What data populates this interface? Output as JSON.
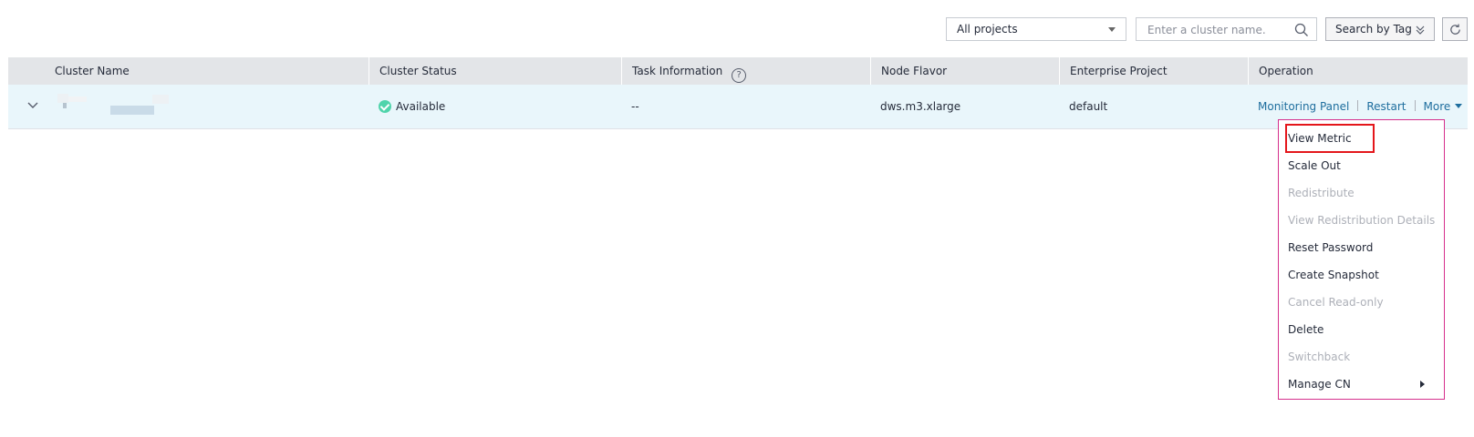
{
  "toolbar": {
    "project_select": "All projects",
    "search_placeholder": "Enter a cluster name.",
    "search_by_tag": "Search by Tag"
  },
  "table": {
    "columns": [
      "Cluster Name",
      "Cluster Status",
      "Task Information",
      "Node Flavor",
      "Enterprise Project",
      "Operation"
    ],
    "row": {
      "cluster_name": "",
      "status": "Available",
      "task_information": "--",
      "node_flavor": "dws.m3.xlarge",
      "enterprise_project": "default",
      "operations": {
        "monitoring_panel": "Monitoring Panel",
        "restart": "Restart",
        "more": "More"
      }
    }
  },
  "more_menu": {
    "items": [
      {
        "label": "View Metric",
        "enabled": true
      },
      {
        "label": "Scale Out",
        "enabled": true
      },
      {
        "label": "Redistribute",
        "enabled": false
      },
      {
        "label": "View Redistribution Details",
        "enabled": false
      },
      {
        "label": "Reset Password",
        "enabled": true
      },
      {
        "label": "Create Snapshot",
        "enabled": true
      },
      {
        "label": "Cancel Read-only",
        "enabled": false
      },
      {
        "label": "Delete",
        "enabled": true
      },
      {
        "label": "Switchback",
        "enabled": false
      },
      {
        "label": "Manage CN",
        "enabled": true
      }
    ]
  },
  "colors": {
    "header_bg": "#e3e5e8",
    "row_bg": "#e9f6fb",
    "link": "#1e6e9e",
    "status_ok": "#50d4ab",
    "menu_border": "#d6308d",
    "highlight": "#e4161b"
  }
}
